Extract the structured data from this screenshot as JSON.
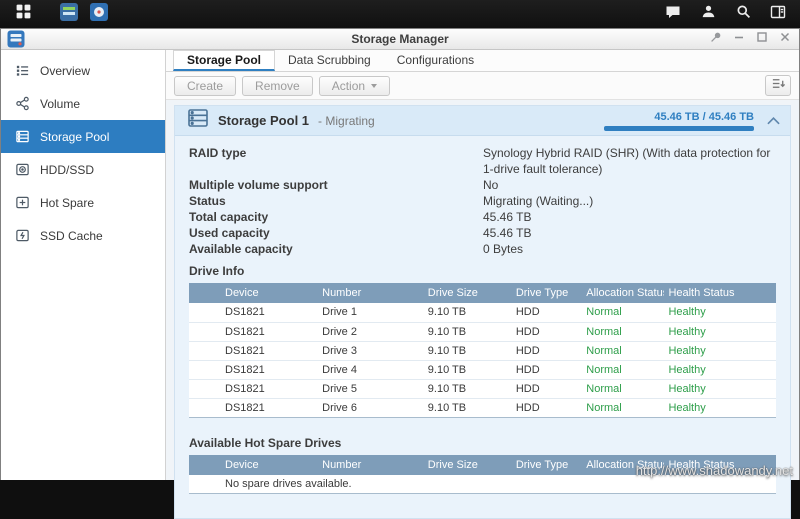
{
  "taskbar": {
    "icons_left": [
      "main-menu-grid",
      "open-app-1",
      "open-app-storage-manager"
    ],
    "icons_right": [
      "chat-bubble",
      "user",
      "search",
      "widgets-panel"
    ]
  },
  "window": {
    "title": "Storage Manager",
    "controls": [
      "pin",
      "minimize",
      "maximize",
      "close"
    ]
  },
  "sidebar": {
    "items": [
      {
        "label": "Overview",
        "active": false
      },
      {
        "label": "Volume",
        "active": false
      },
      {
        "label": "Storage Pool",
        "active": true
      },
      {
        "label": "HDD/SSD",
        "active": false
      },
      {
        "label": "Hot Spare",
        "active": false
      },
      {
        "label": "SSD Cache",
        "active": false
      }
    ]
  },
  "tabs": [
    {
      "label": "Storage Pool",
      "active": true
    },
    {
      "label": "Data Scrubbing",
      "active": false
    },
    {
      "label": "Configurations",
      "active": false
    }
  ],
  "toolbar": {
    "create_label": "Create",
    "remove_label": "Remove",
    "action_label": "Action"
  },
  "pool": {
    "name": "Storage Pool 1",
    "state_suffix": "- Migrating",
    "capacity_text": "45.46 TB / 45.46 TB",
    "progress_percent": 100,
    "details": [
      {
        "label": "RAID type",
        "value": "Synology Hybrid RAID (SHR) (With data protection for 1-drive fault tolerance)"
      },
      {
        "label": "Multiple volume support",
        "value": "No"
      },
      {
        "label": "Status",
        "value": "Migrating (Waiting...)"
      },
      {
        "label": "Total capacity",
        "value": "45.46 TB"
      },
      {
        "label": "Used capacity",
        "value": "45.46 TB"
      },
      {
        "label": "Available capacity",
        "value": "0 Bytes"
      }
    ]
  },
  "drive_info": {
    "title": "Drive Info",
    "columns": [
      "Device",
      "Number",
      "Drive Size",
      "Drive Type",
      "Allocation Status",
      "Health Status"
    ],
    "rows": [
      [
        "DS1821",
        "Drive 1",
        "9.10 TB",
        "HDD",
        "Normal",
        "Healthy"
      ],
      [
        "DS1821",
        "Drive 2",
        "9.10 TB",
        "HDD",
        "Normal",
        "Healthy"
      ],
      [
        "DS1821",
        "Drive 3",
        "9.10 TB",
        "HDD",
        "Normal",
        "Healthy"
      ],
      [
        "DS1821",
        "Drive 4",
        "9.10 TB",
        "HDD",
        "Normal",
        "Healthy"
      ],
      [
        "DS1821",
        "Drive 5",
        "9.10 TB",
        "HDD",
        "Normal",
        "Healthy"
      ],
      [
        "DS1821",
        "Drive 6",
        "9.10 TB",
        "HDD",
        "Normal",
        "Healthy"
      ]
    ]
  },
  "hot_spare": {
    "title": "Available Hot Spare Drives",
    "columns": [
      "Device",
      "Number",
      "Drive Size",
      "Drive Type",
      "Allocation Status",
      "Health Status"
    ],
    "empty_text": "No spare drives available."
  },
  "watermark": "http://www.shadowandy.net",
  "colors": {
    "accent_blue": "#2f7fc1",
    "sidebar_selected": "#2d7dc1",
    "status_green": "#2e9e4a",
    "table_header_bg": "#7e9db9"
  }
}
